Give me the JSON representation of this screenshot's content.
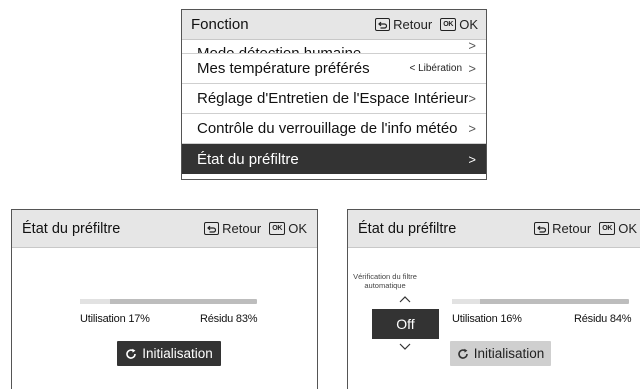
{
  "menu": {
    "title": "Fonction",
    "back_label": "Retour",
    "ok_icon": "OK",
    "ok_label": "OK",
    "items": [
      {
        "label": "Mode détection humaine",
        "value": ""
      },
      {
        "label": "Mes température préférés",
        "value": "Libération"
      },
      {
        "label": "Réglage d'Entretien de l'Espace Intérieur",
        "value": ""
      },
      {
        "label": "Contrôle du verrouillage de l'info météo",
        "value": ""
      },
      {
        "label": "État du préfiltre",
        "value": ""
      }
    ]
  },
  "left_panel": {
    "title": "État du préfiltre",
    "back_label": "Retour",
    "ok_icon": "OK",
    "ok_label": "OK",
    "usage_label": "Utilisation 17%",
    "residue_label": "Résidu 83%",
    "usage_fraction": 0.17,
    "init_label": "Initialisation"
  },
  "right_panel": {
    "title": "État du préfiltre",
    "back_label": "Retour",
    "ok_icon": "OK",
    "ok_label": "OK",
    "auto_check_label": "Vérification du filtre automatique",
    "auto_check_value": "Off",
    "usage_label": "Utilisation 16%",
    "residue_label": "Résidu 84%",
    "usage_fraction": 0.16,
    "init_label": "Initialisation"
  },
  "colors": {
    "selected_row": "#333333",
    "header_bg": "#e6e6e6",
    "progress_track": "#bdbdbd",
    "progress_fill": "#e2e2e2",
    "disabled_button": "#cfcfcf"
  }
}
